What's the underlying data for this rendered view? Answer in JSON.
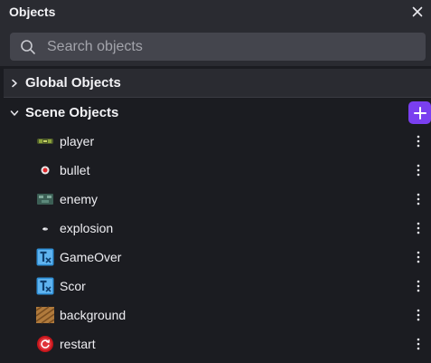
{
  "panel": {
    "title": "Objects"
  },
  "search": {
    "placeholder": "Search objects",
    "value": ""
  },
  "sections": {
    "global": {
      "label": "Global Objects",
      "expanded": false
    },
    "scene": {
      "label": "Scene Objects",
      "expanded": true
    }
  },
  "objects": [
    {
      "name": "player",
      "icon": "player-sprite-icon"
    },
    {
      "name": "bullet",
      "icon": "bullet-sprite-icon"
    },
    {
      "name": "enemy",
      "icon": "enemy-sprite-icon"
    },
    {
      "name": "explosion",
      "icon": "explosion-sprite-icon"
    },
    {
      "name": "GameOver",
      "icon": "text-object-icon"
    },
    {
      "name": "Scor",
      "icon": "text-object-icon"
    },
    {
      "name": "background",
      "icon": "tiled-sprite-icon"
    },
    {
      "name": "restart",
      "icon": "restart-button-icon"
    }
  ],
  "colors": {
    "accent": "#7a3ff0",
    "panel": "#2a2b31",
    "background": "#1b1c21"
  }
}
